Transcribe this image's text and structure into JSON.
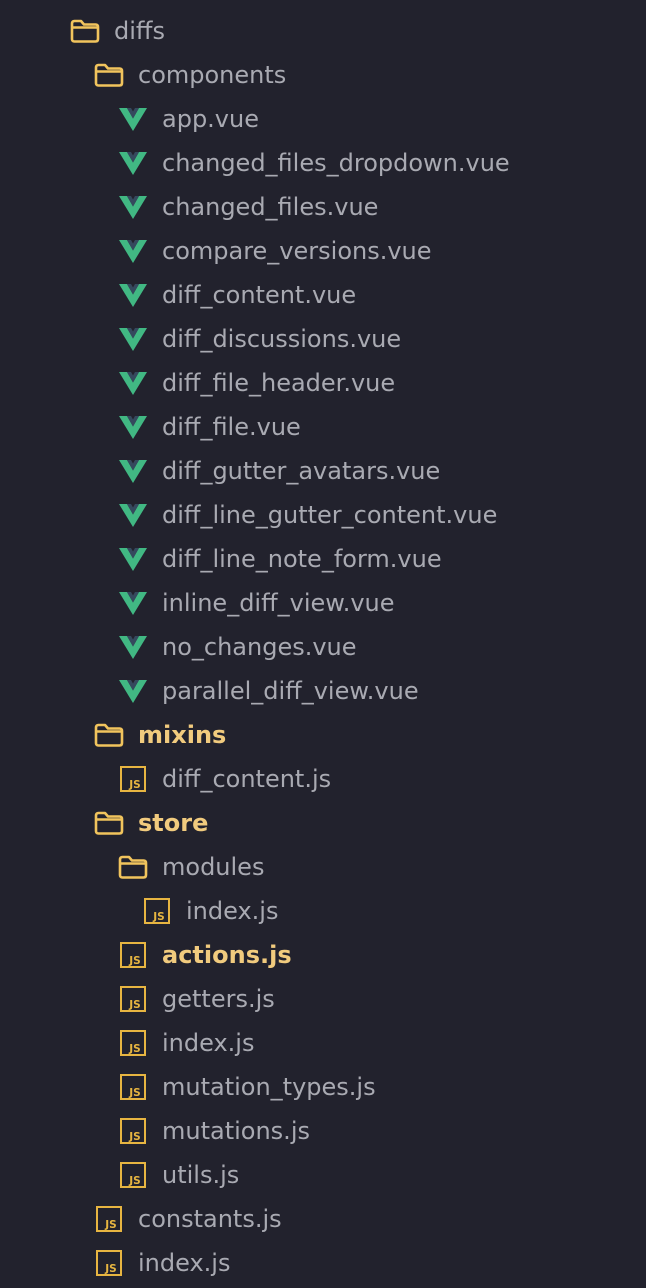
{
  "colors": {
    "background": "#22222d",
    "text": "#a9aab2",
    "modified_text": "#f1cb7e",
    "folder_icon": "#f1c45d",
    "js_icon": "#e7b541",
    "vue_icon_outer": "#41b883",
    "vue_icon_inner": "#35495e"
  },
  "tree": [
    {
      "label": "diffs",
      "icon": "folder-icon",
      "depth": 0,
      "highlight": false
    },
    {
      "label": "components",
      "icon": "folder-icon",
      "depth": 1,
      "highlight": false
    },
    {
      "label": "app.vue",
      "icon": "vue-icon",
      "depth": 2,
      "highlight": false
    },
    {
      "label": "changed_files_dropdown.vue",
      "icon": "vue-icon",
      "depth": 2,
      "highlight": false
    },
    {
      "label": "changed_files.vue",
      "icon": "vue-icon",
      "depth": 2,
      "highlight": false
    },
    {
      "label": "compare_versions.vue",
      "icon": "vue-icon",
      "depth": 2,
      "highlight": false
    },
    {
      "label": "diff_content.vue",
      "icon": "vue-icon",
      "depth": 2,
      "highlight": false
    },
    {
      "label": "diff_discussions.vue",
      "icon": "vue-icon",
      "depth": 2,
      "highlight": false
    },
    {
      "label": "diff_file_header.vue",
      "icon": "vue-icon",
      "depth": 2,
      "highlight": false
    },
    {
      "label": "diff_file.vue",
      "icon": "vue-icon",
      "depth": 2,
      "highlight": false
    },
    {
      "label": "diff_gutter_avatars.vue",
      "icon": "vue-icon",
      "depth": 2,
      "highlight": false
    },
    {
      "label": "diff_line_gutter_content.vue",
      "icon": "vue-icon",
      "depth": 2,
      "highlight": false
    },
    {
      "label": "diff_line_note_form.vue",
      "icon": "vue-icon",
      "depth": 2,
      "highlight": false
    },
    {
      "label": "inline_diff_view.vue",
      "icon": "vue-icon",
      "depth": 2,
      "highlight": false
    },
    {
      "label": "no_changes.vue",
      "icon": "vue-icon",
      "depth": 2,
      "highlight": false
    },
    {
      "label": "parallel_diff_view.vue",
      "icon": "vue-icon",
      "depth": 2,
      "highlight": false
    },
    {
      "label": "mixins",
      "icon": "folder-icon",
      "depth": 1,
      "highlight": true
    },
    {
      "label": "diff_content.js",
      "icon": "js-icon",
      "depth": 2,
      "highlight": false
    },
    {
      "label": "store",
      "icon": "folder-icon",
      "depth": 1,
      "highlight": true
    },
    {
      "label": "modules",
      "icon": "folder-icon",
      "depth": 2,
      "highlight": false
    },
    {
      "label": "index.js",
      "icon": "js-icon",
      "depth": 3,
      "highlight": false
    },
    {
      "label": "actions.js",
      "icon": "js-icon",
      "depth": 2,
      "highlight": true
    },
    {
      "label": "getters.js",
      "icon": "js-icon",
      "depth": 2,
      "highlight": false
    },
    {
      "label": "index.js",
      "icon": "js-icon",
      "depth": 2,
      "highlight": false
    },
    {
      "label": "mutation_types.js",
      "icon": "js-icon",
      "depth": 2,
      "highlight": false
    },
    {
      "label": "mutations.js",
      "icon": "js-icon",
      "depth": 2,
      "highlight": false
    },
    {
      "label": "utils.js",
      "icon": "js-icon",
      "depth": 2,
      "highlight": false
    },
    {
      "label": "constants.js",
      "icon": "js-icon",
      "depth": 1,
      "highlight": false
    },
    {
      "label": "index.js",
      "icon": "js-icon",
      "depth": 1,
      "highlight": false
    }
  ]
}
